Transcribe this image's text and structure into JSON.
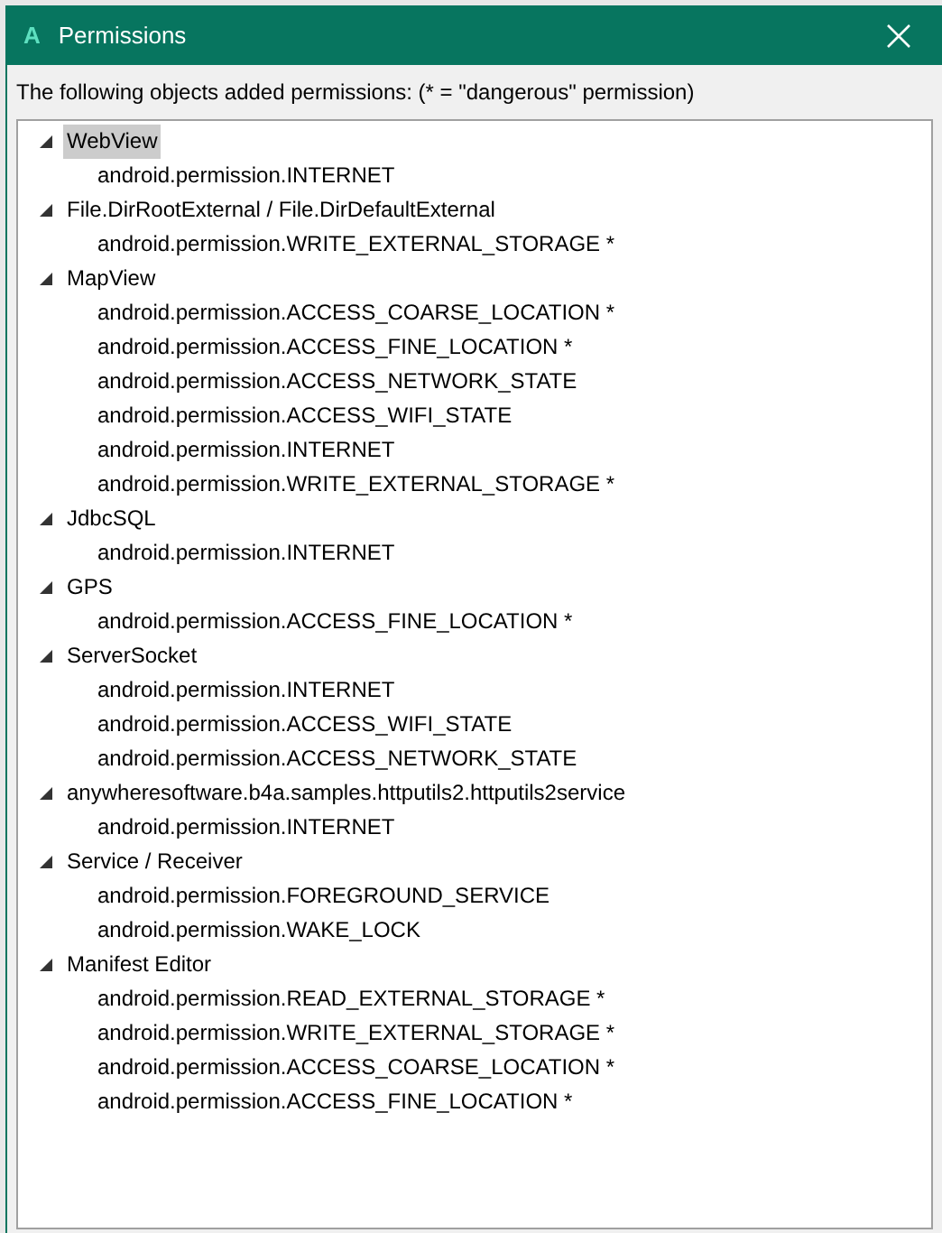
{
  "window": {
    "title": "Permissions",
    "app_letter": "A"
  },
  "intro": "The following objects added permissions: (* = \"dangerous\" permission)",
  "tree": [
    {
      "label": "WebView",
      "expanded": true,
      "selected": true,
      "children": [
        "android.permission.INTERNET"
      ]
    },
    {
      "label": "File.DirRootExternal / File.DirDefaultExternal",
      "expanded": true,
      "selected": false,
      "children": [
        "android.permission.WRITE_EXTERNAL_STORAGE *"
      ]
    },
    {
      "label": "MapView",
      "expanded": true,
      "selected": false,
      "children": [
        "android.permission.ACCESS_COARSE_LOCATION *",
        "android.permission.ACCESS_FINE_LOCATION *",
        "android.permission.ACCESS_NETWORK_STATE",
        "android.permission.ACCESS_WIFI_STATE",
        "android.permission.INTERNET",
        "android.permission.WRITE_EXTERNAL_STORAGE *"
      ]
    },
    {
      "label": "JdbcSQL",
      "expanded": true,
      "selected": false,
      "children": [
        "android.permission.INTERNET"
      ]
    },
    {
      "label": "GPS",
      "expanded": true,
      "selected": false,
      "children": [
        "android.permission.ACCESS_FINE_LOCATION *"
      ]
    },
    {
      "label": "ServerSocket",
      "expanded": true,
      "selected": false,
      "children": [
        "android.permission.INTERNET",
        "android.permission.ACCESS_WIFI_STATE",
        "android.permission.ACCESS_NETWORK_STATE"
      ]
    },
    {
      "label": "anywheresoftware.b4a.samples.httputils2.httputils2service",
      "expanded": true,
      "selected": false,
      "children": [
        "android.permission.INTERNET"
      ]
    },
    {
      "label": "Service / Receiver",
      "expanded": true,
      "selected": false,
      "children": [
        "android.permission.FOREGROUND_SERVICE",
        "android.permission.WAKE_LOCK"
      ]
    },
    {
      "label": "Manifest Editor",
      "expanded": true,
      "selected": false,
      "children": [
        "android.permission.READ_EXTERNAL_STORAGE *",
        "android.permission.WRITE_EXTERNAL_STORAGE *",
        "android.permission.ACCESS_COARSE_LOCATION *",
        "android.permission.ACCESS_FINE_LOCATION *"
      ]
    }
  ]
}
